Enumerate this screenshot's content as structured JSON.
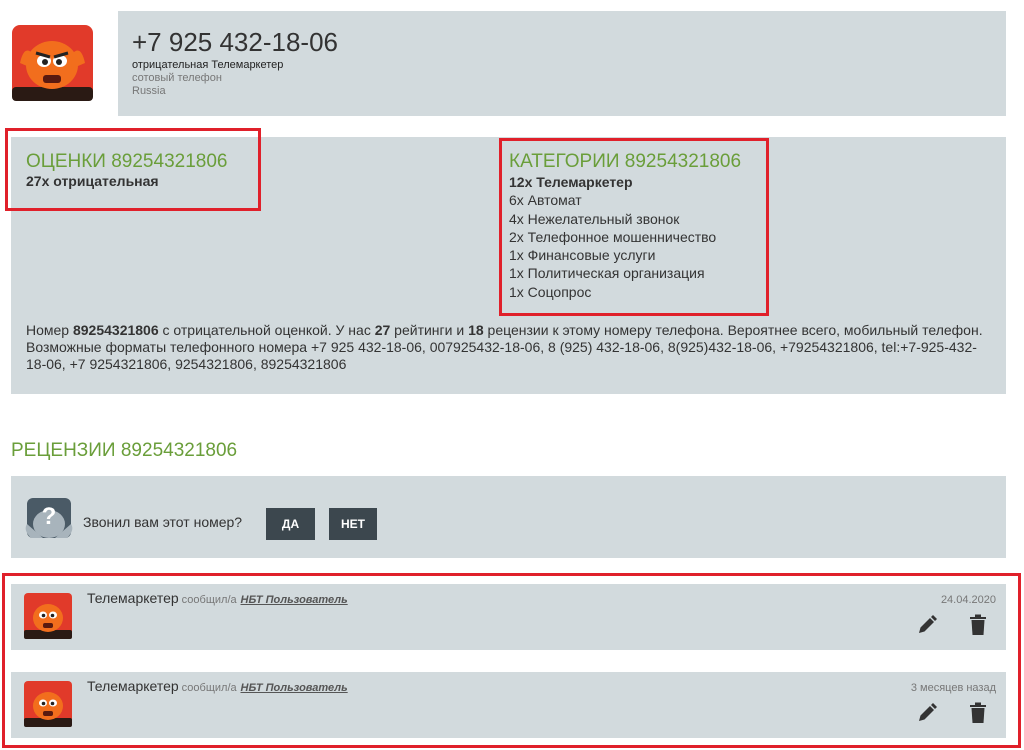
{
  "header": {
    "phone": "+7 925 432-18-06",
    "rating_line": "отрицательная Телемаркетер",
    "type_line": "сотовый телефон",
    "country": "Russia"
  },
  "ratings": {
    "title": "ОЦЕНКИ 89254321806",
    "summary": "27x отрицательная"
  },
  "categories": {
    "title": "КАТЕГОРИИ 89254321806",
    "items": [
      "12x Телемаркетер",
      "6x Автомат",
      "4x Нежелательный звонок",
      "2x Телефонное мошенничество",
      "1x Финансовые услуги",
      "1x Политическая организация",
      "1x Соцопрос"
    ]
  },
  "description": {
    "p1": "Номер ",
    "number": "89254321806",
    "p2": " с отрицательной оценкой. У нас ",
    "ratings_count": "27",
    "p3": " рейтинги и ",
    "reviews_count": "18",
    "p4": " рецензии к этому номеру телефона. Вероятнее всего, мобильный телефон. Возможные форматы телефонного номера +7 925 432-18-06, 007925432-18-06, 8 (925) 432-18-06, 8(925)432-18-06, +79254321806, tel:+7-925-432-18-06, +7 9254321806, 9254321806, 89254321806"
  },
  "reviews": {
    "title": "РЕЦЕНЗИИ 89254321806",
    "question": "Звонил вам этот номер?",
    "yes_label": "ДА",
    "no_label": "НЕТ",
    "items": [
      {
        "category": "Телемаркетер",
        "by": "сообщил/а",
        "user": "НБТ Пользователь",
        "date": "24.04.2020"
      },
      {
        "category": "Телемаркетер",
        "by": "сообщил/а",
        "user": "НБТ Пользователь",
        "date": "3 месяцев назад"
      }
    ]
  },
  "colors": {
    "section_title": "#6a9e3a",
    "panel_bg": "#d2dadd",
    "button_bg": "#3c474e",
    "highlight": "#e0202a"
  }
}
